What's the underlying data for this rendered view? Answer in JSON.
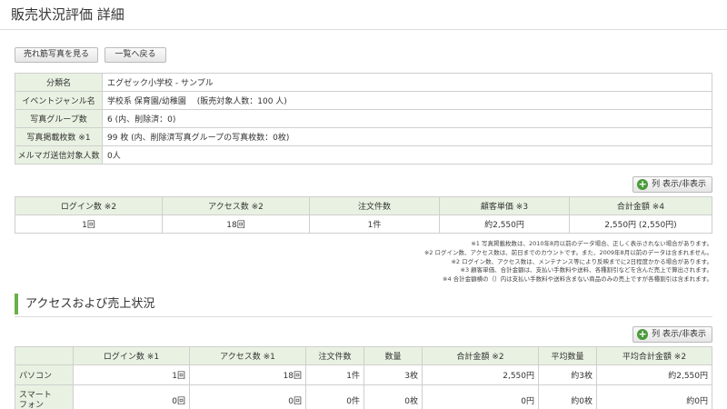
{
  "header": {
    "title": "販売状況評価 詳細"
  },
  "buttons": {
    "best_sellers": "売れ筋写真を見る",
    "back_to_list": "一覧へ戻る"
  },
  "info": [
    {
      "label": "分類名",
      "value": "エグゼック小学校 - サンプル"
    },
    {
      "label": "イベントジャンル名",
      "value": "学校系 保育園/幼稚園 　(販売対象人数：100 人)"
    },
    {
      "label": "写真グループ数",
      "value": "6 (内、削除済：0)"
    },
    {
      "label": "写真掲載枚数 ※1",
      "value": "99 枚 (内、削除済写真グループの写真枚数：0枚)"
    },
    {
      "label": "メルマガ送信対象人数",
      "value": "0人"
    }
  ],
  "column_toggle": {
    "label": "列 表示/非表示"
  },
  "summary": {
    "headers": [
      "ログイン数 ※2",
      "アクセス数 ※2",
      "注文件数",
      "顧客単価 ※3",
      "合計金額 ※4"
    ],
    "row": [
      "1回",
      "18回",
      "1件",
      "約2,550円",
      "2,550円 (2,550円)"
    ]
  },
  "notes": [
    "※1 写真掲載枚数は、2010年8月以前のデータ場合、正しく表示されない場合があります。",
    "※2 ログイン数、アクセス数は、前日までのカウントです。また、2009年8月以前のデータは含まれません。",
    "※2 ログイン数、アクセス数は、メンテナンス等により反映までに2日程度かかる場合があります。",
    "※3 顧客単価、合計金額は、支払い手数料や送料、各種割引などを含んだ売上で算出されます。",
    "※4 合計金額横の（）内は支払い手数料や送料含まない商品のみの売上ですが各種割引は含まれます。"
  ],
  "section": {
    "title": "アクセスおよび売上状況"
  },
  "access": {
    "headers": [
      "",
      "ログイン数 ※1",
      "アクセス数 ※1",
      "注文件数",
      "数量",
      "合計金額 ※2",
      "平均数量",
      "平均合計金額 ※2"
    ],
    "rows": [
      {
        "name": "パソコン",
        "cells": [
          "1回",
          "18回",
          "1件",
          "3枚",
          "2,550円",
          "約3枚",
          "約2,550円"
        ]
      },
      {
        "name": "スマート\nフォン",
        "cells": [
          "0回",
          "0回",
          "0件",
          "0枚",
          "0円",
          "約0枚",
          "約0円"
        ]
      }
    ]
  },
  "colors": {
    "header_bg": "#e9f2e2",
    "accent": "#6ab04c",
    "icon_green": "#4a9a3a"
  }
}
